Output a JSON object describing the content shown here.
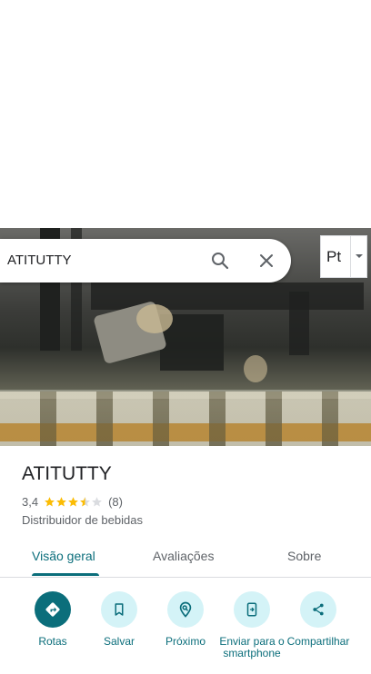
{
  "search": {
    "query": "ATITUTTY"
  },
  "language_selector": {
    "label": "Pt"
  },
  "place": {
    "name": "ATITUTTY",
    "rating": "3,4",
    "rating_value": 3.4,
    "review_count": "(8)",
    "category": "Distribuidor de bebidas"
  },
  "tabs": [
    {
      "label": "Visão geral",
      "active": true
    },
    {
      "label": "Avaliações",
      "active": false
    },
    {
      "label": "Sobre",
      "active": false
    }
  ],
  "actions": [
    {
      "label": "Rotas",
      "icon": "directions-icon"
    },
    {
      "label": "Salvar",
      "icon": "bookmark-icon"
    },
    {
      "label": "Próximo",
      "icon": "nearby-icon"
    },
    {
      "label": "Enviar para o smartphone",
      "icon": "send-to-phone-icon"
    },
    {
      "label": "Compartilhar",
      "icon": "share-icon"
    }
  ],
  "colors": {
    "accent": "#0b6e7b",
    "accent_light": "#d4f3f7",
    "star": "#fbbc04",
    "star_empty": "#dadce0",
    "text_secondary": "#5f6368"
  }
}
